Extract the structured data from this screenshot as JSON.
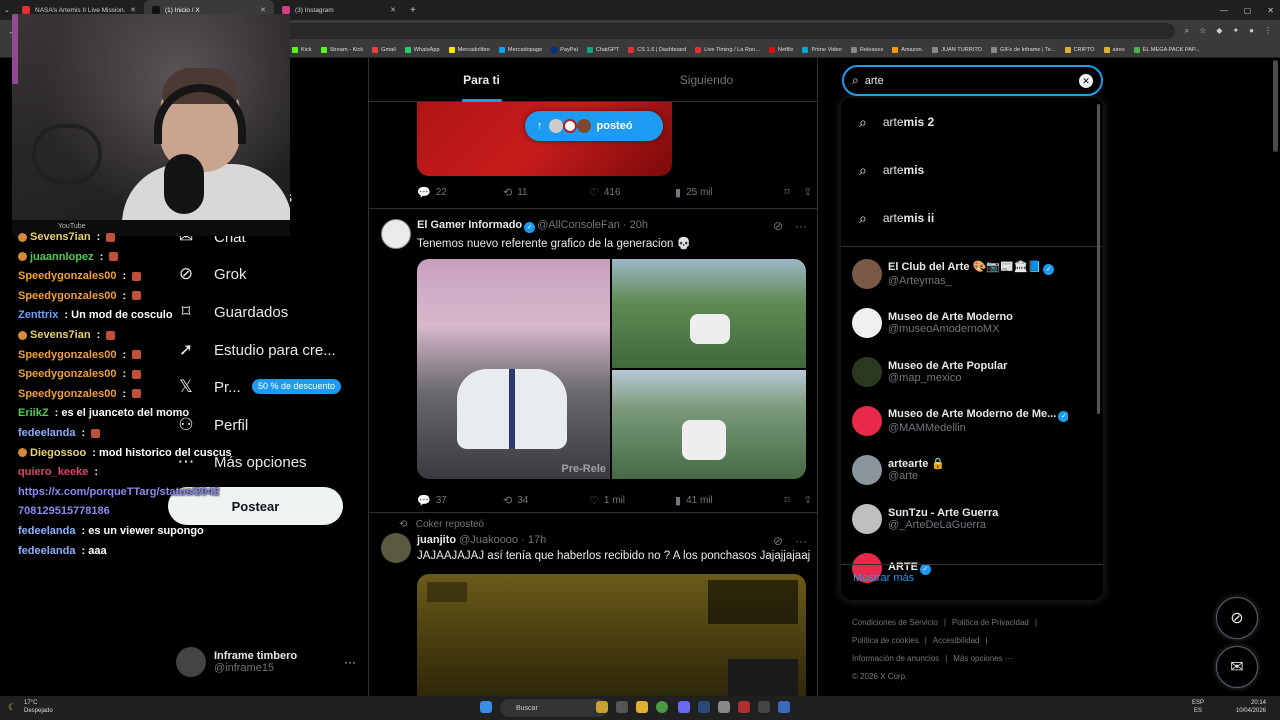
{
  "browser": {
    "tabs": [
      {
        "title": "NASA's Artemis II Live Mission...",
        "fav": "#e03030"
      },
      {
        "title": "(1) Inicio / X",
        "fav": "#111111"
      },
      {
        "title": "(3) Instagram",
        "fav": "#d04080"
      }
    ],
    "bookmarks": [
      "Kick",
      "Stream - Kick",
      "Gmail",
      "WhatsApp",
      "Mercadolibre",
      "Mercadopago",
      "PayPal",
      "ChatGPT",
      "CS 1.6 | Dashboard",
      "Live Timing / La Ron...",
      "Netflix",
      "Prime Video",
      "Releases",
      "Amazon.",
      "JUAN TURRITO",
      "GIFs de Inframe | Te...",
      "CRIPTO",
      "aires",
      "EL MEGA PACK PAP..."
    ]
  },
  "webcam": {
    "strip_text": "YouTube"
  },
  "nav": {
    "items": [
      {
        "label": "Chat",
        "icon": "chat-icon",
        "glyph": "✉"
      },
      {
        "label": "Grok",
        "icon": "grok-icon",
        "glyph": "⊘"
      },
      {
        "label": "Guardados",
        "icon": "bookmark-icon",
        "glyph": "⌑"
      },
      {
        "label": "Estudio para cre...",
        "icon": "rocket-icon",
        "glyph": "➚"
      },
      {
        "label": "Pr...",
        "icon": "x-logo-icon",
        "glyph": "𝕏"
      },
      {
        "label": "Perfil",
        "icon": "person-icon",
        "glyph": "⚇"
      },
      {
        "label": "Más opciones",
        "icon": "more-circle-icon",
        "glyph": "⋯"
      }
    ],
    "partial_label": "nes",
    "promo": "50 % de descuento",
    "post_button": "Postear"
  },
  "profile": {
    "name": "Inframe timbero",
    "handle": "@inframe15"
  },
  "chat": [
    {
      "user": "Sevens7ian",
      "color": "#e8d36a",
      "msg": "",
      "badge": true,
      "pre": true
    },
    {
      "user": "juaannlopez",
      "color": "#4ecf4e",
      "msg": "",
      "badge": true,
      "pre": true
    },
    {
      "user": "Speedygonzales00",
      "color": "#f0a030",
      "msg": "",
      "badge": true
    },
    {
      "user": "Speedygonzales00",
      "color": "#f0a030",
      "msg": "",
      "badge": true
    },
    {
      "user": "Zenttrix",
      "color": "#6fa0ff",
      "msg": "Un mod de cosculo"
    },
    {
      "user": "Sevens7ian",
      "color": "#e8d36a",
      "msg": "",
      "badge": true,
      "pre": true
    },
    {
      "user": "Speedygonzales00",
      "color": "#f0a030",
      "msg": "",
      "badge": true
    },
    {
      "user": "Speedygonzales00",
      "color": "#f0a030",
      "msg": "",
      "badge": true
    },
    {
      "user": "Speedygonzales00",
      "color": "#f0a030",
      "msg": "",
      "badge": true
    },
    {
      "user": "EriikZ",
      "color": "#4ecf4e",
      "msg": "es el juanceto del momo"
    },
    {
      "user": "fedeelanda",
      "color": "#8ab0ff",
      "msg": "",
      "badge": true
    },
    {
      "user": "Diegossoo",
      "color": "#e8d36a",
      "msg": "mod historico del cuscus",
      "pre": true
    },
    {
      "user": "quiero_keeke",
      "color": "#e0406a",
      "msg": ""
    },
    {
      "user": "",
      "color": "#8a8af0",
      "msg": "",
      "link": "https://x.com/porqueTTarg/status/2042"
    },
    {
      "user": "",
      "color": "#8a8af0",
      "msg": "",
      "link": "708129515778186"
    },
    {
      "user": "fedeelanda",
      "color": "#8ab0ff",
      "msg": "es un viewer supongo"
    },
    {
      "user": "fedeelanda",
      "color": "#8ab0ff",
      "msg": "aaa"
    }
  ],
  "timeline": {
    "tabs": [
      "Para ti",
      "Siguiendo"
    ],
    "new_posts_pill": "posteó",
    "post1": {
      "replies": "22",
      "reposts": "11",
      "likes": "416",
      "views": "25 mil"
    },
    "post2": {
      "name": "El Gamer Informado",
      "handle": "@AllConsoleFan",
      "time": "· 20h",
      "text": "Tenemos nuevo referente grafico de la generacion 💀",
      "watermark": "Pre-Rele",
      "replies": "37",
      "reposts": "34",
      "likes": "1 mil",
      "views": "41 mil"
    },
    "post3": {
      "reposter": "Coker reposteó",
      "name": "juanjito",
      "handle": "@Juakoooo",
      "time": "· 17h",
      "text": "JAJAAJAJAJ así tenía que haberlos recibido no ? A los ponchasos Jajajjajaaj"
    }
  },
  "search": {
    "query": "arte",
    "suggestions": [
      {
        "pre": "arte",
        "post": "mis 2"
      },
      {
        "pre": "arte",
        "post": "mis"
      },
      {
        "pre": "arte",
        "post": "mis ii"
      }
    ],
    "accounts": [
      {
        "name": "El Club del Arte 🎨📷📰🏛📘",
        "handle": "@Arteymas_",
        "verified": true,
        "color": "#7a5a44"
      },
      {
        "name": "Museo de Arte Moderno",
        "handle": "@museoAmodernoMX",
        "verified": false,
        "color": "#f0f0f0"
      },
      {
        "name": "Museo de Arte Popular",
        "handle": "@map_mexico",
        "verified": false,
        "color": "#2a3a20"
      },
      {
        "name": "Museo de Arte Moderno de Me...",
        "handle": "@MAMMedellin",
        "verified": true,
        "color": "#e8294a"
      },
      {
        "name": "artearte 🔒",
        "handle": "@arte",
        "verified": false,
        "color": "#8a959e"
      },
      {
        "name": "SunTzu - Arte Guerra",
        "handle": "@_ArteDeLaGuerra",
        "verified": false,
        "color": "#bfbfbf"
      },
      {
        "name": "ARTE",
        "handle": "",
        "verified": true,
        "color": "#e8294a"
      }
    ],
    "show_more": "Mostrar más"
  },
  "footer": {
    "links": [
      "Condiciones de Servicio",
      "|",
      "Política de Privacidad",
      "|",
      "Política de cookies",
      "|",
      "Accesibilidad",
      "|",
      "Información de anuncios",
      "|",
      "Más opciones ···"
    ],
    "copyright": "© 2026 X Corp."
  },
  "taskbar": {
    "temp": "17°C",
    "weather": "Despejado",
    "search": "Buscar",
    "lang1": "ESP",
    "lang2": "ES",
    "time": "20:14",
    "date": "10/04/2026"
  }
}
